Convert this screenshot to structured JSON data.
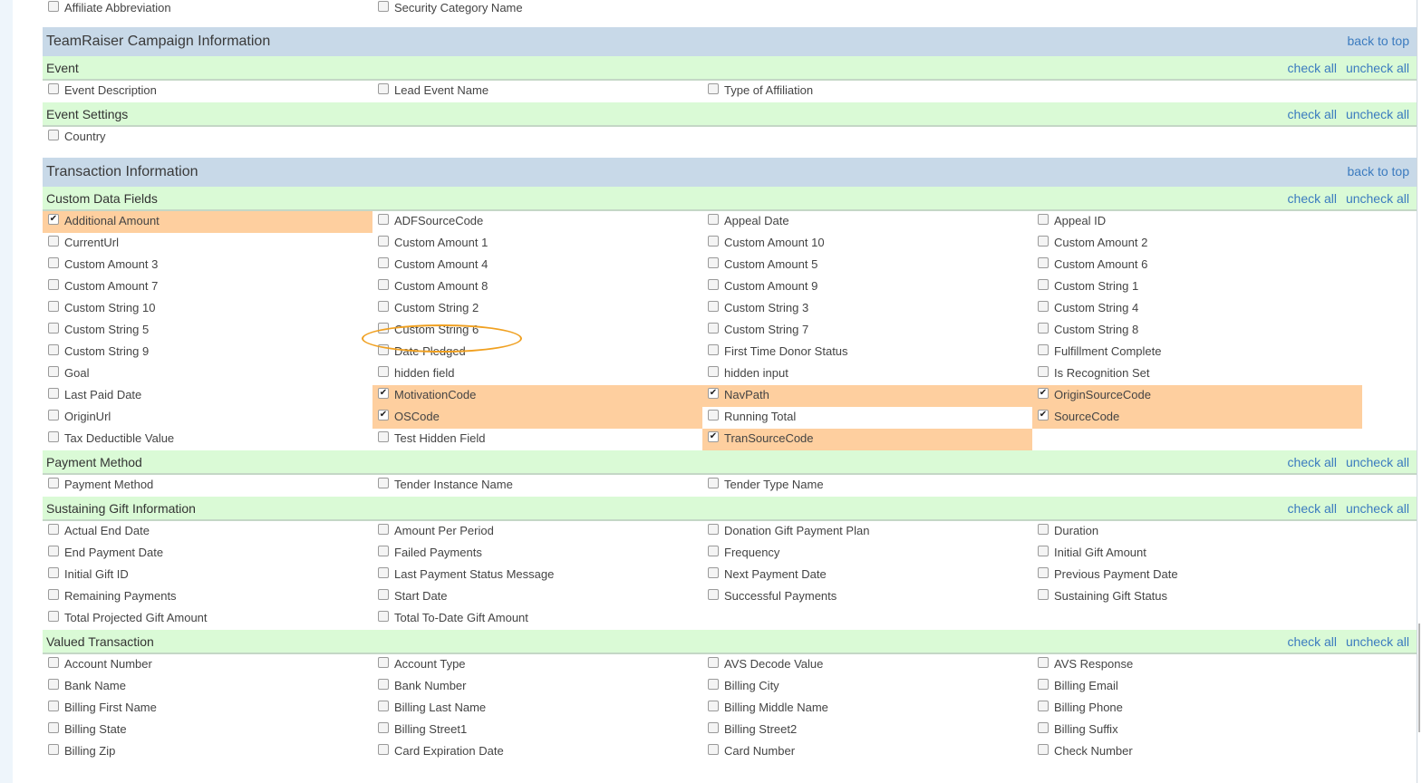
{
  "links": {
    "back_to_top": "back to top",
    "check_all": "check all",
    "uncheck_all": "uncheck all"
  },
  "colors": {
    "section_header": "#c8d9e8",
    "group_header": "#dafad6",
    "selected_row": "#fecf9f",
    "link": "#3b7bbf",
    "annotation": "#f0a020"
  },
  "top_fields": [
    {
      "label": "Affiliate Abbreviation",
      "checked": false,
      "highlight": false
    },
    {
      "label": "Security Category Name",
      "checked": false,
      "highlight": false
    }
  ],
  "sections": [
    {
      "title": "TeamRaiser Campaign Information",
      "groups": [
        {
          "title": "Event",
          "fields": [
            {
              "label": "Event Description",
              "checked": false,
              "highlight": false
            },
            {
              "label": "Lead Event Name",
              "checked": false,
              "highlight": false
            },
            {
              "label": "Type of Affiliation",
              "checked": false,
              "highlight": false
            }
          ]
        },
        {
          "title": "Event Settings",
          "fields": [
            {
              "label": "Country",
              "checked": false,
              "highlight": false
            }
          ]
        }
      ]
    },
    {
      "title": "Transaction Information",
      "groups": [
        {
          "title": "Custom Data Fields",
          "fields": [
            {
              "label": "Additional Amount",
              "checked": true,
              "highlight": true
            },
            {
              "label": "ADFSourceCode",
              "checked": false,
              "highlight": false
            },
            {
              "label": "Appeal Date",
              "checked": false,
              "highlight": false
            },
            {
              "label": "Appeal ID",
              "checked": false,
              "highlight": false
            },
            {
              "label": "CurrentUrl",
              "checked": false,
              "highlight": false
            },
            {
              "label": "Custom Amount 1",
              "checked": false,
              "highlight": false
            },
            {
              "label": "Custom Amount 10",
              "checked": false,
              "highlight": false
            },
            {
              "label": "Custom Amount 2",
              "checked": false,
              "highlight": false
            },
            {
              "label": "Custom Amount 3",
              "checked": false,
              "highlight": false
            },
            {
              "label": "Custom Amount 4",
              "checked": false,
              "highlight": false
            },
            {
              "label": "Custom Amount 5",
              "checked": false,
              "highlight": false
            },
            {
              "label": "Custom Amount 6",
              "checked": false,
              "highlight": false
            },
            {
              "label": "Custom Amount 7",
              "checked": false,
              "highlight": false
            },
            {
              "label": "Custom Amount 8",
              "checked": false,
              "highlight": false
            },
            {
              "label": "Custom Amount 9",
              "checked": false,
              "highlight": false
            },
            {
              "label": "Custom String 1",
              "checked": false,
              "highlight": false
            },
            {
              "label": "Custom String 10",
              "checked": false,
              "highlight": false
            },
            {
              "label": "Custom String 2",
              "checked": false,
              "highlight": false
            },
            {
              "label": "Custom String 3",
              "checked": false,
              "highlight": false
            },
            {
              "label": "Custom String 4",
              "checked": false,
              "highlight": false
            },
            {
              "label": "Custom String 5",
              "checked": false,
              "highlight": false
            },
            {
              "label": "Custom String 6",
              "checked": false,
              "highlight": false,
              "annotated": true
            },
            {
              "label": "Custom String 7",
              "checked": false,
              "highlight": false
            },
            {
              "label": "Custom String 8",
              "checked": false,
              "highlight": false
            },
            {
              "label": "Custom String 9",
              "checked": false,
              "highlight": false
            },
            {
              "label": "Date Pledged",
              "checked": false,
              "highlight": false
            },
            {
              "label": "First Time Donor Status",
              "checked": false,
              "highlight": false
            },
            {
              "label": "Fulfillment Complete",
              "checked": false,
              "highlight": false
            },
            {
              "label": "Goal",
              "checked": false,
              "highlight": false
            },
            {
              "label": "hidden field",
              "checked": false,
              "highlight": false
            },
            {
              "label": "hidden input",
              "checked": false,
              "highlight": false
            },
            {
              "label": "Is Recognition Set",
              "checked": false,
              "highlight": false
            },
            {
              "label": "Last Paid Date",
              "checked": false,
              "highlight": false
            },
            {
              "label": "MotivationCode",
              "checked": true,
              "highlight": true
            },
            {
              "label": "NavPath",
              "checked": true,
              "highlight": true
            },
            {
              "label": "OriginSourceCode",
              "checked": true,
              "highlight": true
            },
            {
              "label": "OriginUrl",
              "checked": false,
              "highlight": false
            },
            {
              "label": "OSCode",
              "checked": true,
              "highlight": true
            },
            {
              "label": "Running Total",
              "checked": false,
              "highlight": false
            },
            {
              "label": "SourceCode",
              "checked": true,
              "highlight": true
            },
            {
              "label": "Tax Deductible Value",
              "checked": false,
              "highlight": false
            },
            {
              "label": "Test Hidden Field",
              "checked": false,
              "highlight": false
            },
            {
              "label": "TranSourceCode",
              "checked": true,
              "highlight": true
            }
          ]
        },
        {
          "title": "Payment Method",
          "fields": [
            {
              "label": "Payment Method",
              "checked": false,
              "highlight": false
            },
            {
              "label": "Tender Instance Name",
              "checked": false,
              "highlight": false
            },
            {
              "label": "Tender Type Name",
              "checked": false,
              "highlight": false
            }
          ]
        },
        {
          "title": "Sustaining Gift Information",
          "fields": [
            {
              "label": "Actual End Date",
              "checked": false,
              "highlight": false
            },
            {
              "label": "Amount Per Period",
              "checked": false,
              "highlight": false
            },
            {
              "label": "Donation Gift Payment Plan",
              "checked": false,
              "highlight": false
            },
            {
              "label": "Duration",
              "checked": false,
              "highlight": false
            },
            {
              "label": "End Payment Date",
              "checked": false,
              "highlight": false
            },
            {
              "label": "Failed Payments",
              "checked": false,
              "highlight": false
            },
            {
              "label": "Frequency",
              "checked": false,
              "highlight": false
            },
            {
              "label": "Initial Gift Amount",
              "checked": false,
              "highlight": false
            },
            {
              "label": "Initial Gift ID",
              "checked": false,
              "highlight": false
            },
            {
              "label": "Last Payment Status Message",
              "checked": false,
              "highlight": false
            },
            {
              "label": "Next Payment Date",
              "checked": false,
              "highlight": false
            },
            {
              "label": "Previous Payment Date",
              "checked": false,
              "highlight": false
            },
            {
              "label": "Remaining Payments",
              "checked": false,
              "highlight": false
            },
            {
              "label": "Start Date",
              "checked": false,
              "highlight": false
            },
            {
              "label": "Successful Payments",
              "checked": false,
              "highlight": false
            },
            {
              "label": "Sustaining Gift Status",
              "checked": false,
              "highlight": false
            },
            {
              "label": "Total Projected Gift Amount",
              "checked": false,
              "highlight": false
            },
            {
              "label": "Total To-Date Gift Amount",
              "checked": false,
              "highlight": false
            }
          ]
        },
        {
          "title": "Valued Transaction",
          "fields": [
            {
              "label": "Account Number",
              "checked": false,
              "highlight": false
            },
            {
              "label": "Account Type",
              "checked": false,
              "highlight": false
            },
            {
              "label": "AVS Decode Value",
              "checked": false,
              "highlight": false
            },
            {
              "label": "AVS Response",
              "checked": false,
              "highlight": false
            },
            {
              "label": "Bank Name",
              "checked": false,
              "highlight": false
            },
            {
              "label": "Bank Number",
              "checked": false,
              "highlight": false
            },
            {
              "label": "Billing City",
              "checked": false,
              "highlight": false
            },
            {
              "label": "Billing Email",
              "checked": false,
              "highlight": false
            },
            {
              "label": "Billing First Name",
              "checked": false,
              "highlight": false
            },
            {
              "label": "Billing Last Name",
              "checked": false,
              "highlight": false
            },
            {
              "label": "Billing Middle Name",
              "checked": false,
              "highlight": false
            },
            {
              "label": "Billing Phone",
              "checked": false,
              "highlight": false
            },
            {
              "label": "Billing State",
              "checked": false,
              "highlight": false
            },
            {
              "label": "Billing Street1",
              "checked": false,
              "highlight": false
            },
            {
              "label": "Billing Street2",
              "checked": false,
              "highlight": false
            },
            {
              "label": "Billing Suffix",
              "checked": false,
              "highlight": false
            },
            {
              "label": "Billing Zip",
              "checked": false,
              "highlight": false
            },
            {
              "label": "Card Expiration Date",
              "checked": false,
              "highlight": false
            },
            {
              "label": "Card Number",
              "checked": false,
              "highlight": false
            },
            {
              "label": "Check Number",
              "checked": false,
              "highlight": false
            }
          ]
        }
      ]
    }
  ]
}
